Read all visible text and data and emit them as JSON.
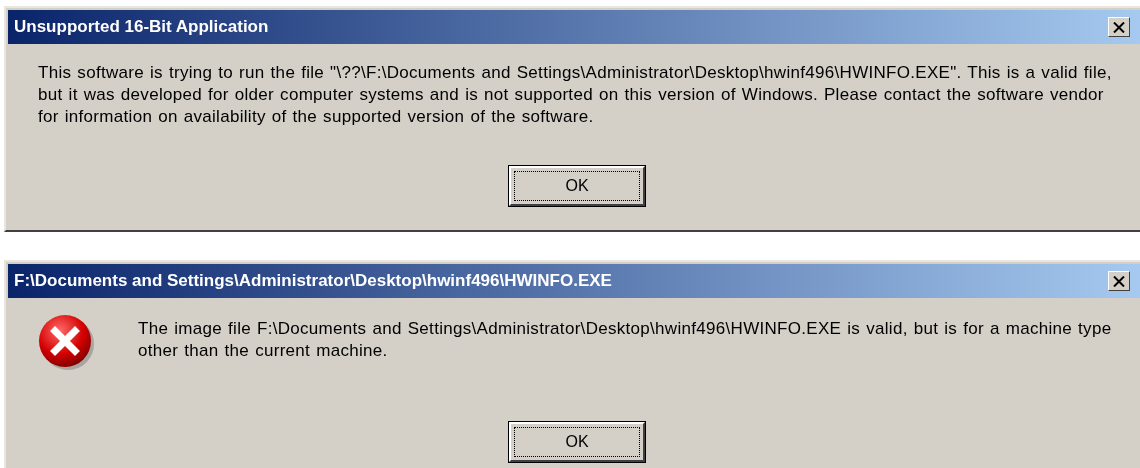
{
  "dialogs": [
    {
      "title": "Unsupported 16-Bit Application",
      "kind": "plain",
      "message": "This software is trying to run the file \"\\??\\F:\\Documents and Settings\\Administrator\\Desktop\\hwinf496\\HWINFO.EXE\".  This is a valid file, but it was developed for older computer systems and is not supported on this version of Windows.  Please contact the software vendor for information on availability of the supported version of the software.",
      "button": {
        "label": "OK",
        "default": true
      }
    },
    {
      "title": "F:\\Documents and Settings\\Administrator\\Desktop\\hwinf496\\HWINFO.EXE",
      "kind": "error",
      "message": "The image file F:\\Documents and Settings\\Administrator\\Desktop\\hwinf496\\HWINFO.EXE is valid, but is for a machine type other than the current machine.",
      "button": {
        "label": "OK",
        "default": true
      }
    }
  ]
}
